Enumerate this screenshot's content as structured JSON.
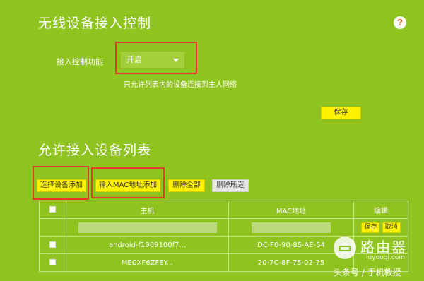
{
  "access_control": {
    "title": "无线设备接入控制",
    "help_icon_glyph": "?",
    "function_label": "接入控制功能",
    "function_value": "开启",
    "hint": "只允许列表内的设备连接到主人网络",
    "save_label": "保存"
  },
  "allow_list": {
    "title": "允许接入设备列表",
    "buttons": {
      "select_device": "选择设备添加",
      "input_mac": "输入MAC地址添加",
      "delete_all": "删除全部",
      "delete_selected": "删除所选"
    },
    "table": {
      "headers": [
        "",
        "主机",
        "MAC地址",
        "编辑"
      ],
      "edit_row": {
        "save": "保存",
        "cancel": "取消"
      },
      "rows": [
        {
          "host": "android-f1909100f7...",
          "mac": "DC-F0-90-85-AE-54"
        },
        {
          "host": "MECXF6ZFEY...",
          "mac": "20-7C-8F-75-02-75"
        }
      ]
    }
  },
  "watermark": {
    "brand": "路由器",
    "domain": "luyouqi.com",
    "source": "头条号 / 手机教授"
  },
  "colors": {
    "background": "#8fc31f",
    "button": "#fff200",
    "highlight": "#e23c2a"
  }
}
